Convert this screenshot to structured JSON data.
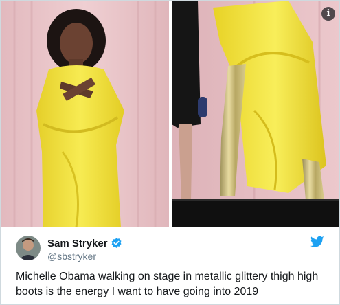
{
  "tweet": {
    "author_name": "Sam Stryker",
    "author_handle": "@sbstryker",
    "verified": true,
    "text": "Michelle Obama walking on stage in metallic glittery thigh high\nboots is the energy I want to have going into 2019",
    "info_glyph": "i",
    "icons": {
      "brand": "twitter-bird-icon",
      "verified": "verified-badge-icon",
      "info": "info-icon"
    },
    "colors": {
      "brand_blue": "#1da1f2",
      "name_text": "#14171a",
      "handle_text": "#657786",
      "dress_yellow": "#f2e23c",
      "backdrop_pink": "#e9c6c9"
    }
  }
}
